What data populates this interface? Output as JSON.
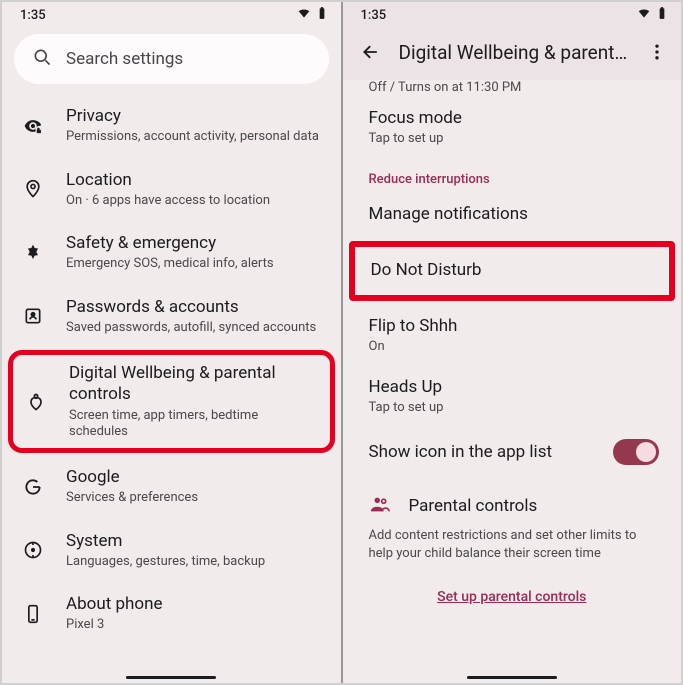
{
  "status": {
    "time": "1:35"
  },
  "left": {
    "search": "Search settings",
    "items": [
      {
        "title": "Privacy",
        "sub": "Permissions, account activity, personal data"
      },
      {
        "title": "Location",
        "sub": "On · 6 apps have access to location"
      },
      {
        "title": "Safety & emergency",
        "sub": "Emergency SOS, medical info, alerts"
      },
      {
        "title": "Passwords & accounts",
        "sub": "Saved passwords, autofill, synced accounts"
      },
      {
        "title": "Digital Wellbeing & parental controls",
        "sub": "Screen time, app timers, bedtime schedules"
      },
      {
        "title": "Google",
        "sub": "Services & preferences"
      },
      {
        "title": "System",
        "sub": "Languages, gestures, time, backup"
      },
      {
        "title": "About phone",
        "sub": "Pixel 3"
      }
    ]
  },
  "right": {
    "title": "Digital Wellbeing & parental...",
    "bedtime_sub": "Off / Turns on at 11:30 PM",
    "focus": {
      "title": "Focus mode",
      "sub": "Tap to set up"
    },
    "section": "Reduce interruptions",
    "manage": "Manage notifications",
    "dnd": "Do Not Disturb",
    "flip": {
      "title": "Flip to Shhh",
      "sub": "On"
    },
    "heads": {
      "title": "Heads Up",
      "sub": "Tap to set up"
    },
    "showicon": "Show icon in the app list",
    "parental": {
      "title": "Parental controls",
      "desc": "Add content restrictions and set other limits to help your child balance their screen time",
      "link": "Set up parental controls"
    }
  }
}
